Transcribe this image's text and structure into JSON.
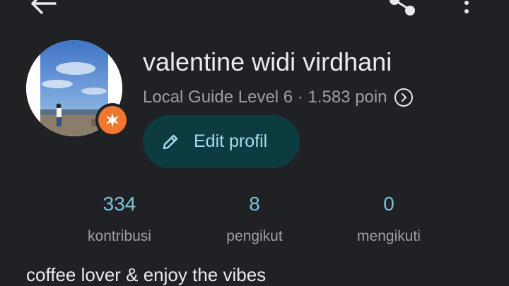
{
  "toolbar": {
    "back_icon": "arrow-back-icon",
    "share_icon": "share-icon",
    "more_icon": "more-vert-icon"
  },
  "profile": {
    "name": "valentine widi virdhani",
    "level_text": "Local Guide Level 6 · 1.583 poin",
    "badge_icon": "local-guide-star-icon",
    "badge_color": "#f0772e",
    "edit_button_label": "Edit profil",
    "bio": "coffee lover & enjoy the vibes"
  },
  "stats": [
    {
      "value": "334",
      "label": "kontribusi"
    },
    {
      "value": "8",
      "label": "pengikut"
    },
    {
      "value": "0",
      "label": "mengikuti"
    }
  ],
  "colors": {
    "background": "#202124",
    "accent": "#7cc2d6",
    "edit_button_bg": "#0c3c3f",
    "edit_button_text": "#a8dcec"
  }
}
